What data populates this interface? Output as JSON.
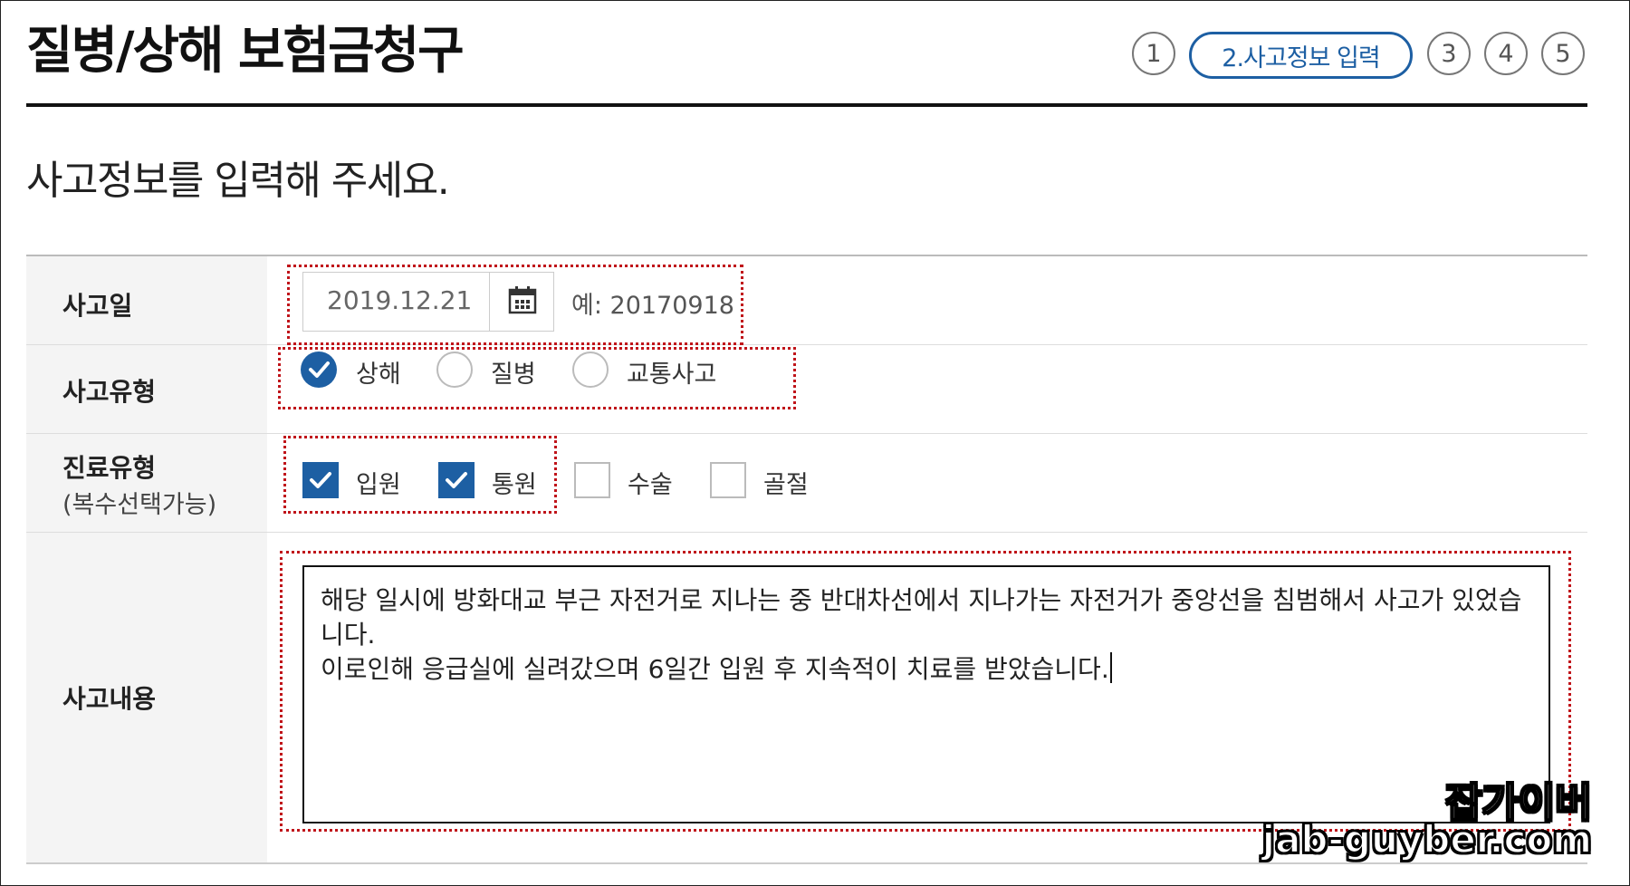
{
  "header": {
    "title": "질병/상해 보험금청구",
    "steps": [
      {
        "label": "1",
        "active": false
      },
      {
        "label": "2.사고정보 입력",
        "active": true
      },
      {
        "label": "3",
        "active": false
      },
      {
        "label": "4",
        "active": false
      },
      {
        "label": "5",
        "active": false
      }
    ]
  },
  "subtitle": "사고정보를 입력해 주세요.",
  "form": {
    "accident_date": {
      "label": "사고일",
      "value": "2019.12.21",
      "calendar_icon": "calendar-icon",
      "hint": "예: 20170918"
    },
    "accident_type": {
      "label": "사고유형",
      "options": [
        {
          "label": "상해",
          "selected": true
        },
        {
          "label": "질병",
          "selected": false
        },
        {
          "label": "교통사고",
          "selected": false
        }
      ]
    },
    "treatment_type": {
      "label": "진료유형",
      "sublabel": "(복수선택가능)",
      "options": [
        {
          "label": "입원",
          "checked": true
        },
        {
          "label": "통원",
          "checked": true
        },
        {
          "label": "수술",
          "checked": false
        },
        {
          "label": "골절",
          "checked": false
        }
      ]
    },
    "accident_details": {
      "label": "사고내용",
      "line1": "해당 일시에 방화대교 부근 자전거로 지나는 중 반대차선에서 지나가는 자전거가 중앙선을 침범해서 사고가 있었습니다.",
      "line2": "이로인해 응급실에 실려갔으며 6일간 입원 후 지속적이 치료를 받았습니다."
    }
  },
  "watermark": {
    "name": "잡가이버",
    "url": "jab-guyber.com"
  },
  "colors": {
    "accent": "#1d5fa3",
    "highlight": "#c0141a"
  }
}
